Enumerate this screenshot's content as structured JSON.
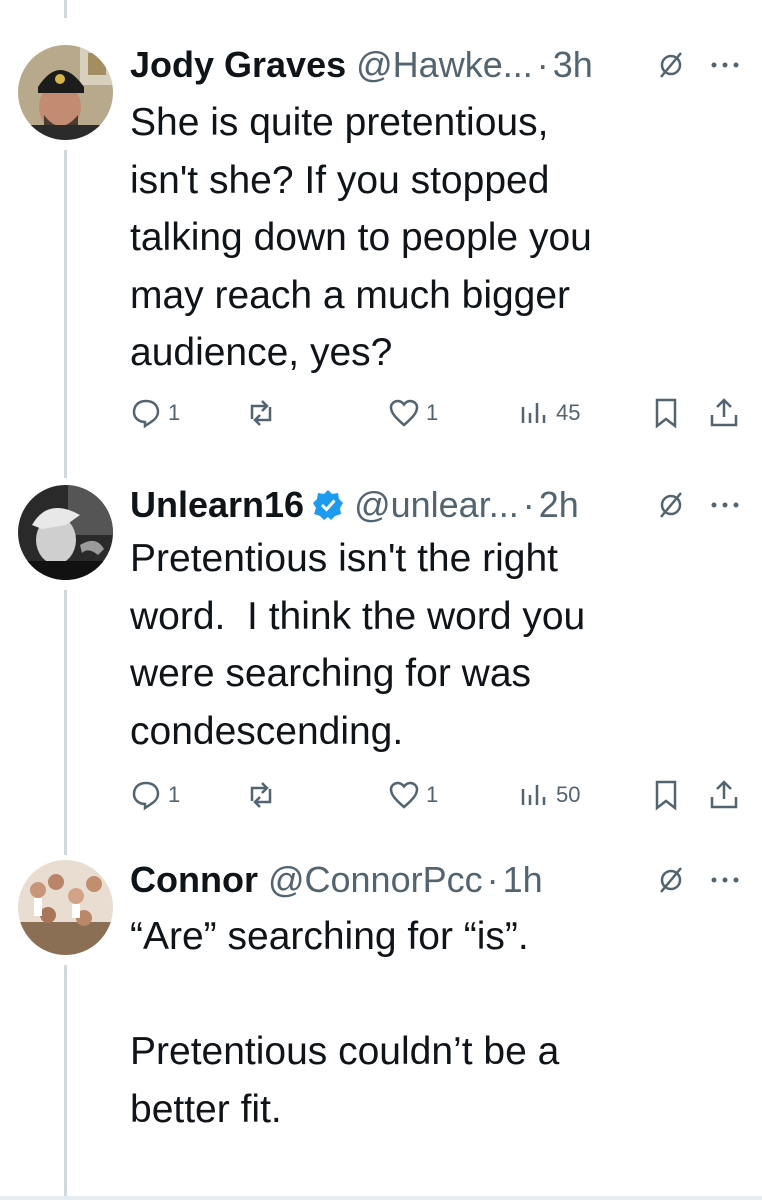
{
  "tweets": [
    {
      "name": "Jody Graves",
      "handle": "@Hawke...",
      "sep": "·",
      "time": "3h",
      "text": "She is quite pretentious,\nisn't she? If you stopped\ntalking down to people you\nmay reach a much bigger\naudience, yes?",
      "replies": "1",
      "retweets": "",
      "likes": "1",
      "views": "45",
      "verified": false,
      "avatar_icon": "user-avatar-beanie"
    },
    {
      "name": "Unlearn16",
      "handle": "@unlear...",
      "sep": "·",
      "time": "2h",
      "text": "Pretentious isn't the right\nword.  I think the word you\nwere searching for was\ncondescending.",
      "replies": "1",
      "retweets": "",
      "likes": "1",
      "views": "50",
      "verified": true,
      "avatar_icon": "user-avatar-bw"
    },
    {
      "name": "Connor",
      "handle": "@ConnorPcc",
      "sep": "·",
      "time": "1h",
      "text": "“Are” searching for “is”.\n\nPretentious couldn’t be a\nbetter fit.",
      "verified": false,
      "avatar_icon": "user-avatar-group"
    }
  ],
  "colors": {
    "text": "#0f1419",
    "secondary": "#536471",
    "verified": "#1d9bf0",
    "thread_line": "#cfd9de"
  }
}
